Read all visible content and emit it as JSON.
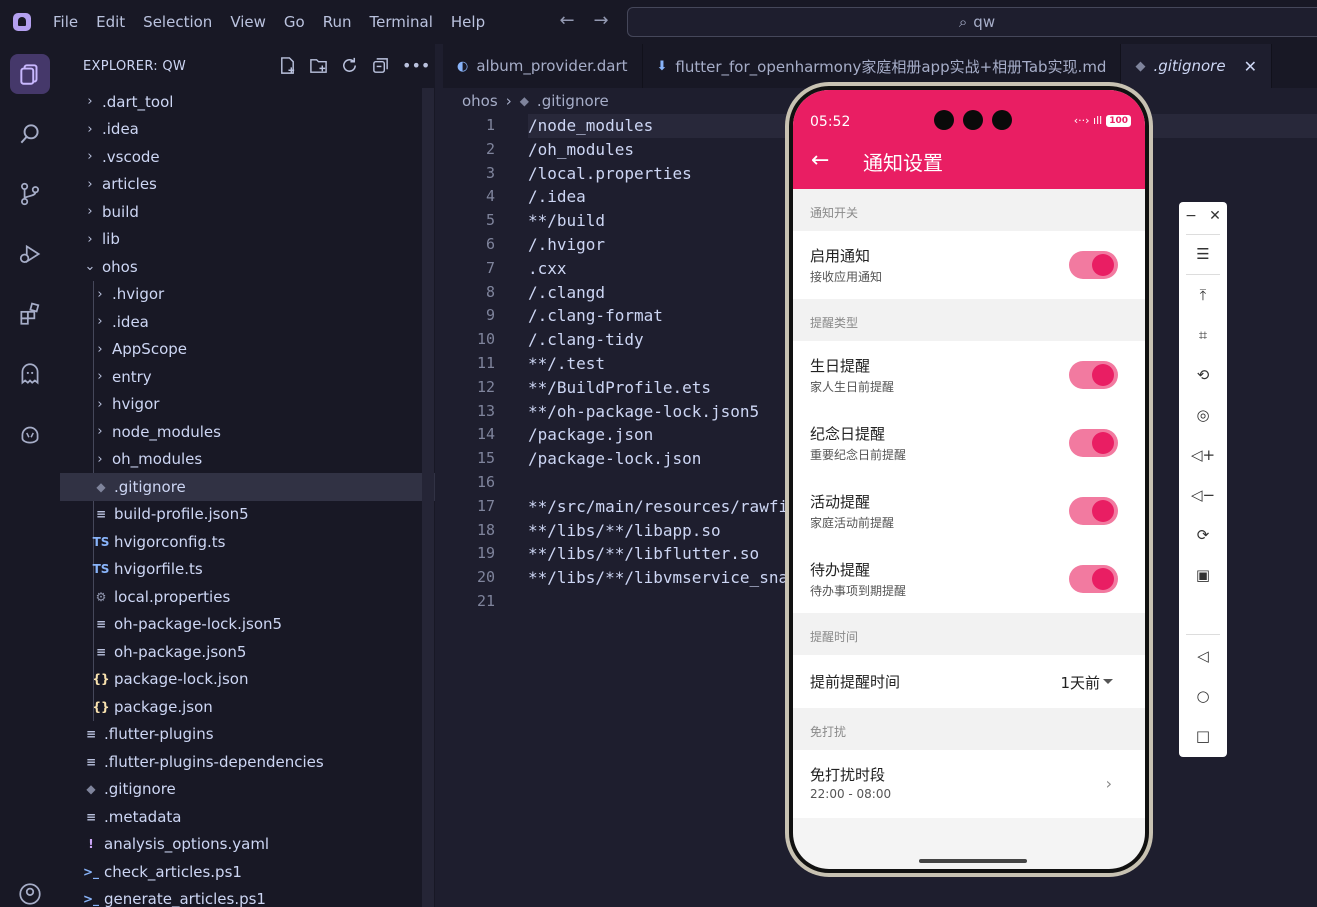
{
  "menubar": {
    "items": [
      "File",
      "Edit",
      "Selection",
      "View",
      "Go",
      "Run",
      "Terminal",
      "Help"
    ],
    "back_icon": "arrow-left-icon",
    "forward_icon": "arrow-right-icon"
  },
  "search": {
    "value": "qw"
  },
  "sidebar": {
    "title": "EXPLORER: QW",
    "tree": [
      {
        "label": ".dart_tool",
        "type": "folder",
        "depth": 0,
        "expanded": false
      },
      {
        "label": ".idea",
        "type": "folder",
        "depth": 0,
        "expanded": false
      },
      {
        "label": ".vscode",
        "type": "folder",
        "depth": 0,
        "expanded": false
      },
      {
        "label": "articles",
        "type": "folder",
        "depth": 0,
        "expanded": false
      },
      {
        "label": "build",
        "type": "folder",
        "depth": 0,
        "expanded": false
      },
      {
        "label": "lib",
        "type": "folder",
        "depth": 0,
        "expanded": false
      },
      {
        "label": "ohos",
        "type": "folder",
        "depth": 0,
        "expanded": true
      },
      {
        "label": ".hvigor",
        "type": "folder",
        "depth": 1,
        "expanded": false
      },
      {
        "label": ".idea",
        "type": "folder",
        "depth": 1,
        "expanded": false
      },
      {
        "label": "AppScope",
        "type": "folder",
        "depth": 1,
        "expanded": false
      },
      {
        "label": "entry",
        "type": "folder",
        "depth": 1,
        "expanded": false
      },
      {
        "label": "hvigor",
        "type": "folder",
        "depth": 1,
        "expanded": false
      },
      {
        "label": "node_modules",
        "type": "folder",
        "depth": 1,
        "expanded": false
      },
      {
        "label": "oh_modules",
        "type": "folder",
        "depth": 1,
        "expanded": false
      },
      {
        "label": ".gitignore",
        "type": "git",
        "depth": 1,
        "selected": true
      },
      {
        "label": "build-profile.json5",
        "type": "lines",
        "depth": 1
      },
      {
        "label": "hvigorconfig.ts",
        "type": "ts",
        "depth": 1
      },
      {
        "label": "hvigorfile.ts",
        "type": "ts",
        "depth": 1
      },
      {
        "label": "local.properties",
        "type": "gear",
        "depth": 1
      },
      {
        "label": "oh-package-lock.json5",
        "type": "lines",
        "depth": 1
      },
      {
        "label": "oh-package.json5",
        "type": "lines",
        "depth": 1
      },
      {
        "label": "package-lock.json",
        "type": "json",
        "depth": 1
      },
      {
        "label": "package.json",
        "type": "json",
        "depth": 1
      },
      {
        "label": ".flutter-plugins",
        "type": "lines",
        "depth": 0
      },
      {
        "label": ".flutter-plugins-dependencies",
        "type": "lines",
        "depth": 0
      },
      {
        "label": ".gitignore",
        "type": "git",
        "depth": 0
      },
      {
        "label": ".metadata",
        "type": "lines",
        "depth": 0
      },
      {
        "label": "analysis_options.yaml",
        "type": "yaml",
        "depth": 0
      },
      {
        "label": "check_articles.ps1",
        "type": "ps",
        "depth": 0
      },
      {
        "label": "generate_articles.ps1",
        "type": "ps",
        "depth": 0
      }
    ]
  },
  "tabs": [
    {
      "label": "album_provider.dart",
      "icon": "dart-icon",
      "active": false
    },
    {
      "label": "flutter_for_openharmony家庭相册app实战+相册Tab实现.md",
      "icon": "markdown-icon",
      "active": false
    },
    {
      "label": ".gitignore",
      "icon": "git-icon",
      "active": true
    }
  ],
  "breadcrumb": [
    "ohos",
    ".gitignore"
  ],
  "code_lines": [
    "/node_modules",
    "/oh_modules",
    "/local.properties",
    "/.idea",
    "**/build",
    "/.hvigor",
    ".cxx",
    "/.clangd",
    "/.clang-format",
    "/.clang-tidy",
    "**/.test",
    "**/BuildProfile.ets",
    "**/oh-package-lock.json5",
    "/package.json",
    "/package-lock.json",
    "",
    "**/src/main/resources/rawfi",
    "**/libs/**/libapp.so",
    "**/libs/**/libflutter.so",
    "**/libs/**/libvmservice_sna",
    ""
  ],
  "phone": {
    "status_time": "05:52",
    "battery": "100",
    "title": "通知设置",
    "colors": {
      "primary": "#e91e63",
      "toggle_track": "#f27aa0"
    },
    "sections": [
      {
        "title": "通知开关",
        "items": [
          {
            "title": "启用通知",
            "subtitle": "接收应用通知",
            "toggle": true
          }
        ]
      },
      {
        "title": "提醒类型",
        "items": [
          {
            "title": "生日提醒",
            "subtitle": "家人生日前提醒",
            "toggle": true
          },
          {
            "title": "纪念日提醒",
            "subtitle": "重要纪念日前提醒",
            "toggle": true
          },
          {
            "title": "活动提醒",
            "subtitle": "家庭活动前提醒",
            "toggle": true
          },
          {
            "title": "待办提醒",
            "subtitle": "待办事项到期提醒",
            "toggle": true
          }
        ]
      },
      {
        "title": "提醒时间",
        "dropdown": {
          "label": "提前提醒时间",
          "value": "1天前"
        }
      },
      {
        "title": "免打扰",
        "nav": {
          "title": "免打扰时段",
          "subtitle": "22:00 - 08:00"
        }
      }
    ]
  },
  "side_toolbar": {
    "icons": [
      "menu-icon",
      "pin-top-icon",
      "crop-icon",
      "rotate-icon",
      "screenshot-icon",
      "volume-up-icon",
      "volume-down-icon",
      "rotate-device-icon",
      "screen-record-icon",
      "back-nav-icon",
      "home-nav-icon",
      "recent-nav-icon"
    ]
  }
}
